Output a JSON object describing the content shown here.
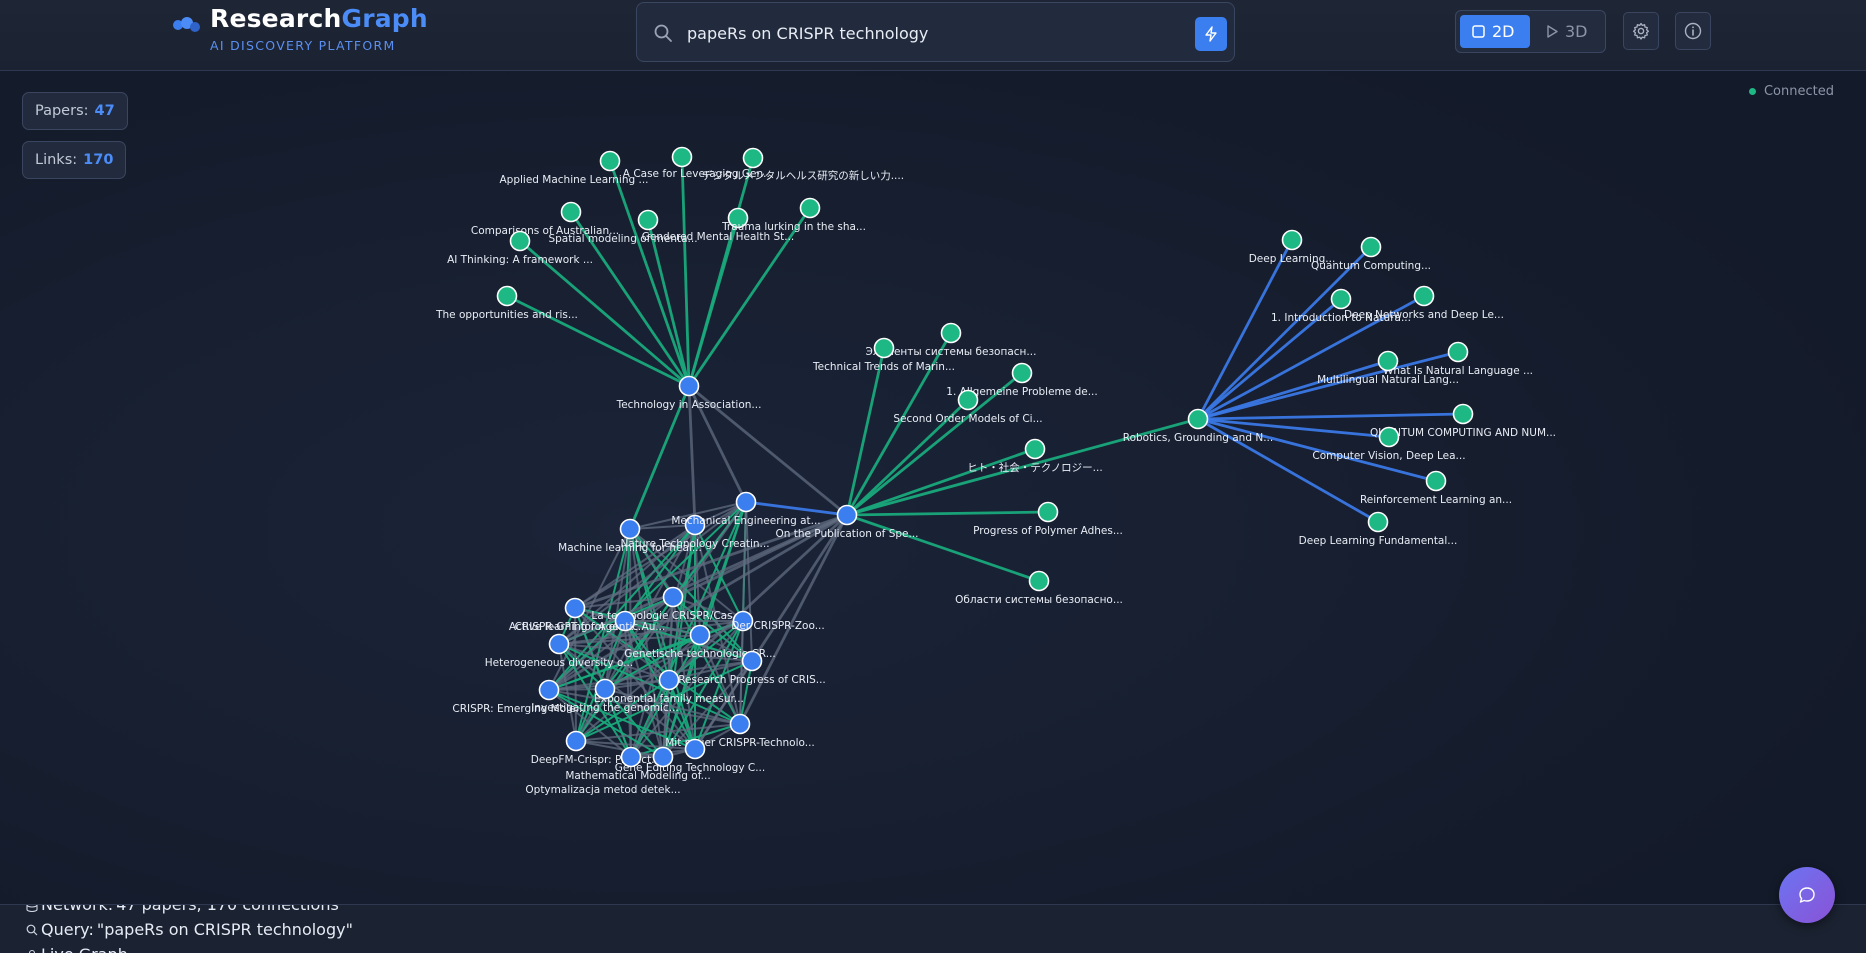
{
  "header": {
    "brand_part1": "Research",
    "brand_part2": "Graph",
    "tagline": "AI DISCOVERY PLATFORM",
    "search_value": "papeRs on CRISPR technology",
    "view_2d": "2D",
    "view_3d": "3D"
  },
  "stats": {
    "papers_label": "Papers:",
    "papers_value": "47",
    "links_label": "Links:",
    "links_value": "170"
  },
  "status": {
    "connection": "Connected"
  },
  "footer": {
    "network_label": "Network:",
    "network_value": "47 papers, 170 connections",
    "query_label": "Query:",
    "query_value": "\"papeRs on CRISPR technology\"",
    "live_label": "Live Graph"
  },
  "colors": {
    "accent_blue": "#3b7ef0",
    "node_green": "#1db884",
    "edge_green": "#19a97b",
    "edge_blue": "#3a78e6",
    "edge_gray": "#616c80"
  },
  "graph": {
    "nodes": [
      {
        "id": "tech",
        "label": "Technology in Association...",
        "type": "blue"
      },
      {
        "id": "g1",
        "label": "Applied Machine Learning ...",
        "type": "green"
      },
      {
        "id": "g2",
        "label": "A Case for Leveraging Gen...",
        "type": "green"
      },
      {
        "id": "g3",
        "label": "デジタルメンタルヘルス研究の新しい力....",
        "type": "green"
      },
      {
        "id": "g4",
        "label": "Comparisons of Australian...",
        "type": "green"
      },
      {
        "id": "g5",
        "label": "Spatial modeling of menta...",
        "type": "green"
      },
      {
        "id": "g6",
        "label": "Gendered Mental Health St...",
        "type": "green"
      },
      {
        "id": "g7",
        "label": "Trauma lurking in the sha...",
        "type": "green"
      },
      {
        "id": "g8",
        "label": "AI Thinking: A framework ...",
        "type": "green"
      },
      {
        "id": "g9",
        "label": "The opportunities and ris...",
        "type": "green"
      },
      {
        "id": "pub",
        "label": "On the Publication of Spe...",
        "type": "blue"
      },
      {
        "id": "h1",
        "label": "Элементы системы безопасн...",
        "type": "green"
      },
      {
        "id": "h2",
        "label": "Technical Trends of Marin...",
        "type": "green"
      },
      {
        "id": "h3",
        "label": "1. Allgemeine Probleme de...",
        "type": "green"
      },
      {
        "id": "h4",
        "label": "Second Order Models of Ci...",
        "type": "green"
      },
      {
        "id": "h5",
        "label": "ヒト・社会・テクノロジー...",
        "type": "green"
      },
      {
        "id": "h6",
        "label": "Progress of Polymer Adhes...",
        "type": "green"
      },
      {
        "id": "h7",
        "label": "Области системы безопасно...",
        "type": "green"
      },
      {
        "id": "rob",
        "label": "Robotics, Grounding and N...",
        "type": "green"
      },
      {
        "id": "r1",
        "label": "Deep Learning...",
        "type": "green"
      },
      {
        "id": "r2",
        "label": "Quantum Computing...",
        "type": "green"
      },
      {
        "id": "r3",
        "label": "1. Introduction to Natura...",
        "type": "green"
      },
      {
        "id": "r4",
        "label": "Deep Networks and Deep Le...",
        "type": "green"
      },
      {
        "id": "r5",
        "label": "What Is Natural Language ...",
        "type": "green"
      },
      {
        "id": "r6",
        "label": "Multilingual Natural Lang...",
        "type": "green"
      },
      {
        "id": "r7",
        "label": "QUANTUM COMPUTING AND NUM...",
        "type": "green"
      },
      {
        "id": "r8",
        "label": "Computer Vision, Deep Lea...",
        "type": "green"
      },
      {
        "id": "r9",
        "label": "Reinforcement Learning an...",
        "type": "green"
      },
      {
        "id": "r10",
        "label": "Deep Learning Fundamental...",
        "type": "green"
      },
      {
        "id": "c1",
        "label": "Machine learning for heal...",
        "type": "blue"
      },
      {
        "id": "c2",
        "label": "Nature Technology Creatin...",
        "type": "blue"
      },
      {
        "id": "c3",
        "label": "Mechanical Engineering at...",
        "type": "blue"
      },
      {
        "id": "c4",
        "label": "Active learning for effic...",
        "type": "blue"
      },
      {
        "id": "c5",
        "label": "La technologie CRISPR/Cas...",
        "type": "blue"
      },
      {
        "id": "c6",
        "label": "CRISPR-GPT for Agentic Au...",
        "type": "blue"
      },
      {
        "id": "c7",
        "label": "Der CRISPR-Zoo...",
        "type": "blue"
      },
      {
        "id": "c8",
        "label": "Genetische technologie CR...",
        "type": "blue"
      },
      {
        "id": "c9",
        "label": "Heterogeneous diversity o...",
        "type": "blue"
      },
      {
        "id": "c10",
        "label": "Research Progress of CRIS...",
        "type": "blue"
      },
      {
        "id": "c11",
        "label": "Exponential family measur...",
        "type": "blue"
      },
      {
        "id": "c12",
        "label": "CRISPR: Emerging Mole...",
        "type": "blue"
      },
      {
        "id": "c13",
        "label": "Investigating the genomic...",
        "type": "blue"
      },
      {
        "id": "c14",
        "label": "Mit neuer CRISPR-Technolo...",
        "type": "blue"
      },
      {
        "id": "c15",
        "label": "DeepFM-Crispr: Predict...",
        "type": "blue"
      },
      {
        "id": "c16",
        "label": "Gene Editing Technology C...",
        "type": "blue"
      },
      {
        "id": "c17",
        "label": "Mathematical Modeling of...",
        "type": "blue"
      },
      {
        "id": "c18",
        "label": "Optymalizacja metod detek...",
        "type": "blue"
      }
    ]
  }
}
